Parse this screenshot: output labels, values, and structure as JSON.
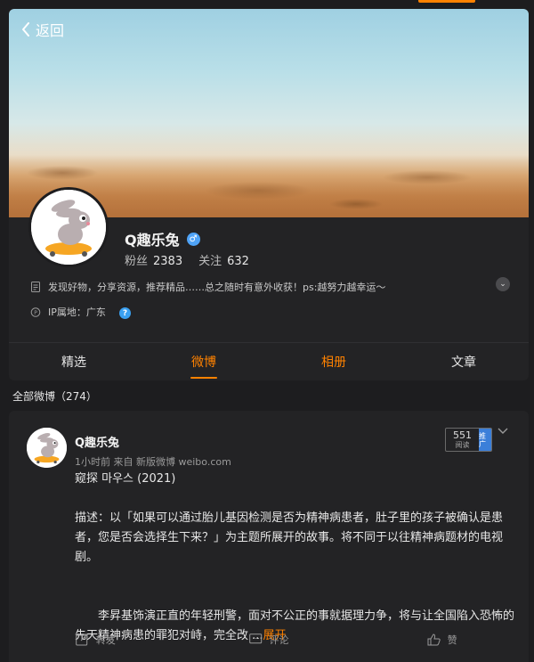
{
  "header": {
    "back_label": "返回"
  },
  "profile": {
    "name": "Q趣乐兔",
    "gender": "♂",
    "fans_label": "粉丝",
    "fans_count": "2383",
    "following_label": "关注",
    "following_count": "632",
    "bio": "发现好物，分享资源，推荐精品……总之随时有意外收获！ps:越努力越幸运～",
    "ip": "IP属地：广东"
  },
  "tabs": [
    {
      "label": "精选"
    },
    {
      "label": "微博"
    },
    {
      "label": "相册"
    },
    {
      "label": "文章"
    }
  ],
  "feed": {
    "section_title": "全部微博（274）"
  },
  "post": {
    "author": "Q趣乐兔",
    "meta": "1小时前  来自 新版微博 weibo.com",
    "read_count": "551",
    "read_unit": "阅读",
    "promo_label": "推广",
    "title": "窥探 마우스 (2021)",
    "desc": "描述：以「如果可以通过胎儿基因检测是否为精神病患者，肚子里的孩子被确认是患者，您是否会选择生下来？」为主题所展开的故事。将不同于以往精神病题材的电视剧。",
    "desc2": "　　李昇基饰演正直的年轻刑警，面对不公正的事就据理力争，将与让全国陷入恐怖的先天精神病患的罪犯对峙，完全改 ...",
    "expand_label": "展开",
    "actions": {
      "repost": "转发",
      "comment": "评论",
      "like": "赞"
    }
  },
  "colors": {
    "accent": "#ff8200",
    "background": "#1d1d1f",
    "card": "#232325"
  }
}
